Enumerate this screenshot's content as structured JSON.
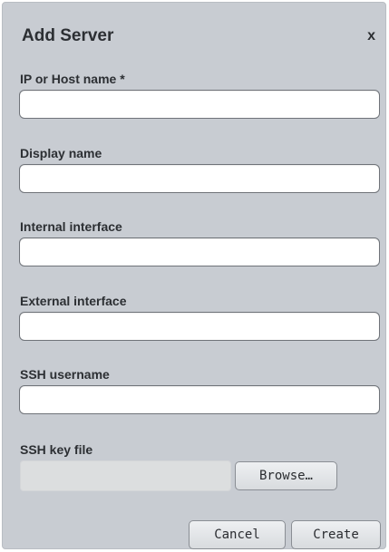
{
  "dialog": {
    "title": "Add Server",
    "close_label": "x"
  },
  "fields": {
    "host": {
      "label": "IP or Host name *",
      "value": ""
    },
    "display_name": {
      "label": "Display name",
      "value": ""
    },
    "internal_interface": {
      "label": "Internal interface",
      "value": ""
    },
    "external_interface": {
      "label": "External interface",
      "value": ""
    },
    "ssh_username": {
      "label": "SSH username",
      "value": ""
    },
    "ssh_key_file": {
      "label": "SSH key file",
      "value": ""
    }
  },
  "buttons": {
    "browse": "Browse…",
    "cancel": "Cancel",
    "create": "Create"
  }
}
